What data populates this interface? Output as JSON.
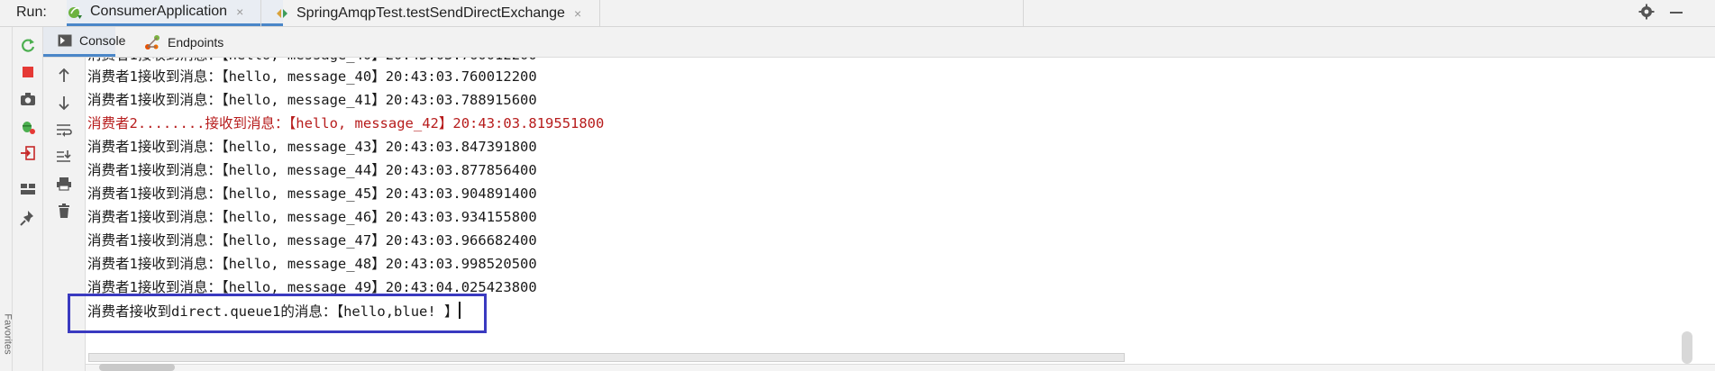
{
  "run_panel": {
    "label": "Run:",
    "tabs": [
      {
        "label": "ConsumerApplication",
        "active": true
      },
      {
        "label": "SpringAmqpTest.testSendDirectExchange",
        "active": false
      }
    ],
    "close_glyph": "×"
  },
  "subtabs": [
    {
      "label": "Console",
      "icon": "console-icon",
      "active": true
    },
    {
      "label": "Endpoints",
      "icon": "endpoints-icon",
      "active": false
    }
  ],
  "side_label": "Favorites",
  "console": {
    "lines": [
      {
        "text": "消费者1接收到消息：【hello, message_40】20:43:03.760012200",
        "kind": "normal"
      },
      {
        "text": "消费者1接收到消息：【hello, message_41】20:43:03.788915600",
        "kind": "normal"
      },
      {
        "text": "消费者2........接收到消息：【hello, message_42】20:43:03.819551800",
        "kind": "error"
      },
      {
        "text": "消费者1接收到消息：【hello, message_43】20:43:03.847391800",
        "kind": "normal"
      },
      {
        "text": "消费者1接收到消息：【hello, message_44】20:43:03.877856400",
        "kind": "normal"
      },
      {
        "text": "消费者1接收到消息：【hello, message_45】20:43:03.904891400",
        "kind": "normal"
      },
      {
        "text": "消费者1接收到消息：【hello, message_46】20:43:03.934155800",
        "kind": "normal"
      },
      {
        "text": "消费者1接收到消息：【hello, message_47】20:43:03.966682400",
        "kind": "normal"
      },
      {
        "text": "消费者1接收到消息：【hello, message_48】20:43:03.998520500",
        "kind": "normal"
      },
      {
        "text": "消费者1接收到消息：【hello, message_49】20:43:04.025423800",
        "kind": "normal"
      },
      {
        "text": "消费者接收到direct.queue1的消息：【hello,blue! 】",
        "kind": "normal"
      }
    ]
  },
  "colors": {
    "accent": "#4a86c8",
    "error_text": "#b71c1c",
    "highlight_box": "#3a3ac0",
    "rerun_green": "#4caf50",
    "stop_red": "#e53935"
  }
}
